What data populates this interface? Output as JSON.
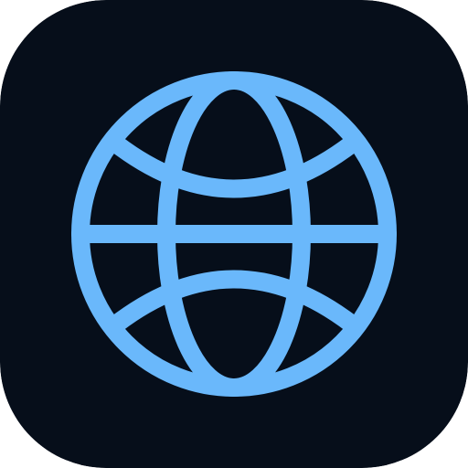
{
  "icon": {
    "name": "globe-icon",
    "background_color": "#060e1a",
    "stroke_color": "#6ab8fb"
  }
}
